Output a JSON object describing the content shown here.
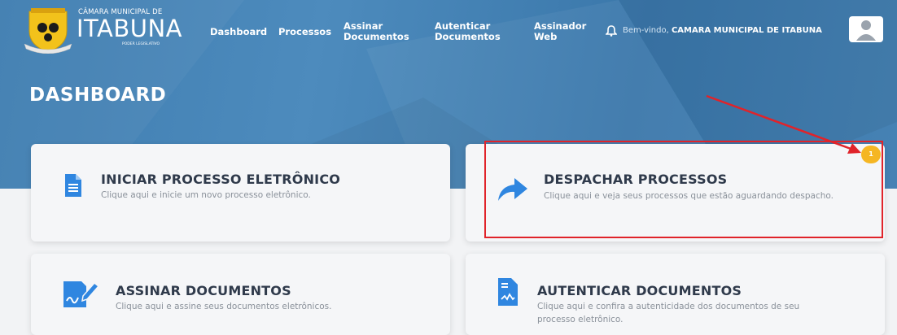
{
  "header": {
    "logo": {
      "caption": "CÂMARA MUNICIPAL DE",
      "city": "ITABUNA",
      "subtitle": "PODER LEGISLATIVO"
    },
    "nav": [
      {
        "label": "Dashboard"
      },
      {
        "label": "Processos"
      },
      {
        "label": "Assinar\nDocumentos"
      },
      {
        "label": "Autenticar\nDocumentos"
      },
      {
        "label": "Assinador\nWeb"
      }
    ],
    "welcome_label": "Bem-vindo,",
    "username": "CAMARA MUNICIPAL DE ITABUNA"
  },
  "page": {
    "title": "DASHBOARD"
  },
  "cards": [
    {
      "title": "INICIAR PROCESSO ELETRÔNICO",
      "description": "Clique aqui e inicie um novo processo eletrônico.",
      "icon": "document-icon"
    },
    {
      "title": "DESPACHAR PROCESSOS",
      "description": "Clique aqui e veja seus processos que estão aguardando despacho.",
      "icon": "share-arrow-icon",
      "badge": "1"
    },
    {
      "title": "ASSINAR DOCUMENTOS",
      "description": "Clique aqui e assine seus documentos eletrônicos.",
      "icon": "signature-icon"
    },
    {
      "title": "AUTENTICAR DOCUMENTOS",
      "description": "Clique aqui e confira a autenticidade dos documentos de seu processo eletrônico.",
      "icon": "certificate-icon"
    }
  ],
  "colors": {
    "hero": "#4682b4",
    "accent_icon": "#2f86e0",
    "badge": "#f5b623",
    "annotation": "#e0232a"
  }
}
